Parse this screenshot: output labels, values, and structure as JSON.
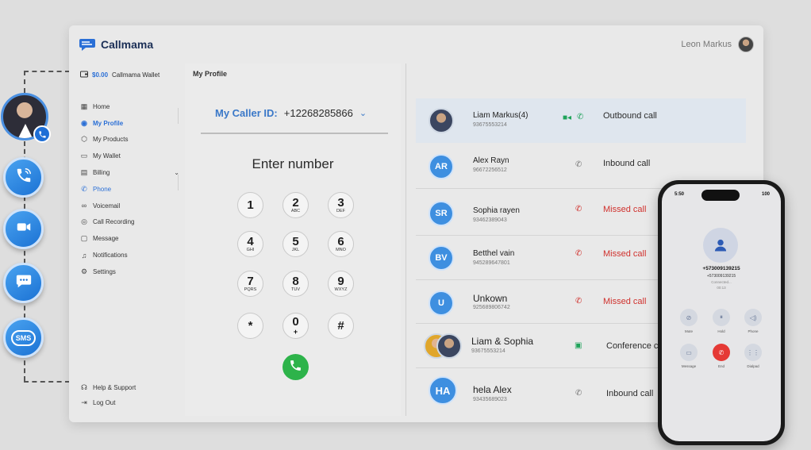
{
  "app": {
    "brand": "Callmama",
    "user_name": "Leon Markus"
  },
  "sidebar": {
    "wallet_amount": "$0.00",
    "wallet_label": "Callmama Wallet",
    "items": [
      {
        "label": "Home",
        "icon": "grid-icon"
      },
      {
        "label": "My Profile",
        "icon": "profile-icon",
        "active": true
      },
      {
        "label": "My Products",
        "icon": "box-icon"
      },
      {
        "label": "My Wallet",
        "icon": "wallet-icon"
      },
      {
        "label": "Billing",
        "icon": "billing-icon"
      },
      {
        "label": "Phone",
        "icon": "phone-icon"
      },
      {
        "label": "Voicemail",
        "icon": "voicemail-icon"
      },
      {
        "label": "Call Recording",
        "icon": "mic-icon"
      },
      {
        "label": "Message",
        "icon": "message-icon"
      },
      {
        "label": "Notifications",
        "icon": "bell-icon"
      },
      {
        "label": "Settings",
        "icon": "gear-icon"
      }
    ],
    "help": "Help & Support",
    "logout": "Log Out"
  },
  "dialer": {
    "section_title": "My Profile",
    "caller_id_label": "My Caller ID:",
    "caller_id_value": "+12268285866",
    "enter_number": "Enter number",
    "keys": [
      {
        "digit": "1",
        "letters": ""
      },
      {
        "digit": "2",
        "letters": "ABC"
      },
      {
        "digit": "3",
        "letters": "DEF"
      },
      {
        "digit": "4",
        "letters": "GHI"
      },
      {
        "digit": "5",
        "letters": "JKL"
      },
      {
        "digit": "6",
        "letters": "MNO"
      },
      {
        "digit": "7",
        "letters": "PQRS"
      },
      {
        "digit": "8",
        "letters": "TUV"
      },
      {
        "digit": "9",
        "letters": "WXYZ"
      },
      {
        "digit": "*",
        "letters": ""
      },
      {
        "digit": "0",
        "letters": "+"
      },
      {
        "digit": "#",
        "letters": ""
      }
    ]
  },
  "calls": [
    {
      "initials": "",
      "name": "Liam Markus(4)",
      "number": "93675553214",
      "type": "Outbound call",
      "status": "outbound"
    },
    {
      "initials": "AR",
      "name": "Alex Rayn",
      "number": "96672256512",
      "type": "Inbound call",
      "status": "inbound"
    },
    {
      "initials": "SR",
      "name": "Sophia rayen",
      "number": "93462389043",
      "type": "Missed call",
      "status": "missed"
    },
    {
      "initials": "BV",
      "name": "Betthel vain",
      "number": "945289647801",
      "type": "Missed call",
      "status": "missed"
    },
    {
      "initials": "U",
      "name": "Unkown",
      "number": "925689806742",
      "type": "Missed call",
      "status": "missed"
    },
    {
      "initials": "",
      "name": "Liam & Sophia",
      "number": "93675553214",
      "type": "Conference c",
      "status": "conference"
    },
    {
      "initials": "HA",
      "name": "hela Alex",
      "number": "93435689023",
      "type": "Inbound call",
      "status": "inbound"
    }
  ],
  "phone": {
    "time": "5:50",
    "battery": "100",
    "number": "+573009139215",
    "number_small": "+573009139215",
    "status": "Connected...",
    "timer": "00:13",
    "buttons": [
      "Mute",
      "Hold",
      "Phone",
      "Message",
      "End",
      "Dialpad"
    ]
  },
  "colors": {
    "accent": "#2a6fd6",
    "missed": "#d0312d",
    "call_green": "#2db34a",
    "end_red": "#e53935"
  }
}
